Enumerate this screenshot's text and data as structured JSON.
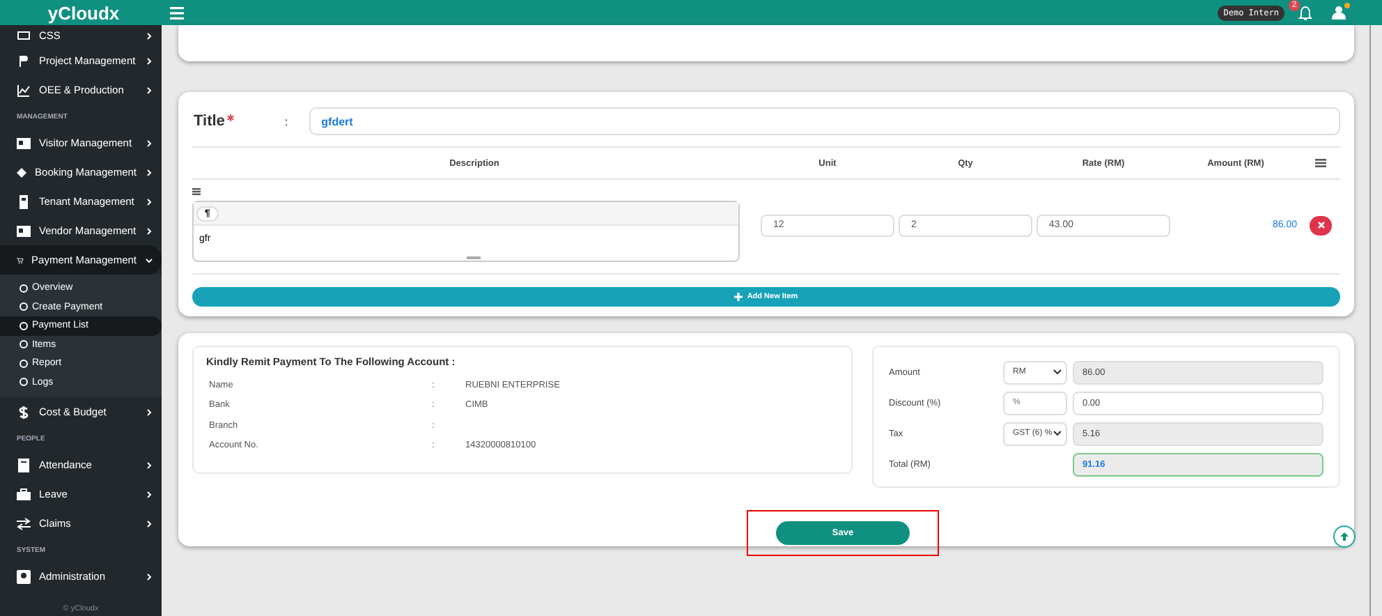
{
  "topbar": {
    "brand": "yCloudx",
    "user_tag": "Demo Intern",
    "notification_count": "2",
    "user_badge": true
  },
  "sidebar": {
    "items": [
      {
        "kind": "item",
        "label": "CSS",
        "expanded": false
      },
      {
        "kind": "item",
        "label": "Project Management",
        "expanded": false
      },
      {
        "kind": "item",
        "label": "OEE & Production",
        "expanded": false
      },
      {
        "kind": "section",
        "label": "MANAGEMENT"
      },
      {
        "kind": "item",
        "label": "Visitor Management",
        "expanded": false
      },
      {
        "kind": "item",
        "label": "Booking Management",
        "expanded": false
      },
      {
        "kind": "item",
        "label": "Tenant Management",
        "expanded": false
      },
      {
        "kind": "item",
        "label": "Vendor Management",
        "expanded": false
      },
      {
        "kind": "item",
        "label": "Payment Management",
        "expanded": true,
        "children": [
          {
            "label": "Overview",
            "selected": false
          },
          {
            "label": "Create Payment",
            "selected": false
          },
          {
            "label": "Payment List",
            "selected": true
          },
          {
            "label": "Items",
            "selected": false
          },
          {
            "label": "Report",
            "selected": false
          },
          {
            "label": "Logs",
            "selected": false
          }
        ]
      },
      {
        "kind": "item",
        "label": "Cost & Budget",
        "expanded": false
      },
      {
        "kind": "section",
        "label": "PEOPLE"
      },
      {
        "kind": "item",
        "label": "Attendance",
        "expanded": false
      },
      {
        "kind": "item",
        "label": "Leave",
        "expanded": false
      },
      {
        "kind": "item",
        "label": "Claims",
        "expanded": false
      },
      {
        "kind": "section",
        "label": "SYSTEM"
      },
      {
        "kind": "item",
        "label": "Administration",
        "expanded": false
      }
    ],
    "footer": "© yCloudx"
  },
  "form": {
    "title_label": "Title",
    "required": true,
    "separator": ":",
    "title_value": "gfdert",
    "columns": [
      "Description",
      "Unit",
      "Qty",
      "Rate (RM)",
      "Amount (RM)"
    ],
    "items": [
      {
        "editor_button": "¶",
        "description": "gfr",
        "unit": "12",
        "qty": "2",
        "rate": "43.00",
        "amount": "86.00"
      }
    ],
    "add_button": "Add New Item"
  },
  "remit": {
    "heading": "Kindly Remit Payment To The Following Account :",
    "rows": [
      {
        "label": "Name",
        "separator": ":",
        "value": "RUEBNI ENTERPRISE"
      },
      {
        "label": "Bank",
        "separator": ":",
        "value": "CIMB"
      },
      {
        "label": "Branch",
        "separator": ":"
      },
      {
        "label": "Account No.",
        "separator": ":",
        "value": "14320000810100"
      }
    ]
  },
  "summary": {
    "rows": [
      {
        "kind": "select",
        "label": "Amount",
        "option": "RM",
        "value": "86.00",
        "readonly": true
      },
      {
        "kind": "input",
        "label": "Discount (%)",
        "placeholder": "%",
        "value": "0.00",
        "readonly": false
      },
      {
        "kind": "select",
        "label": "Tax",
        "option": "GST (6) %",
        "value": "5.16",
        "readonly": true
      },
      {
        "kind": "total",
        "label": "Total (RM)",
        "value": "91.16",
        "readonly": true
      }
    ]
  },
  "save_button": {
    "label": "Save",
    "highlighted": true
  }
}
